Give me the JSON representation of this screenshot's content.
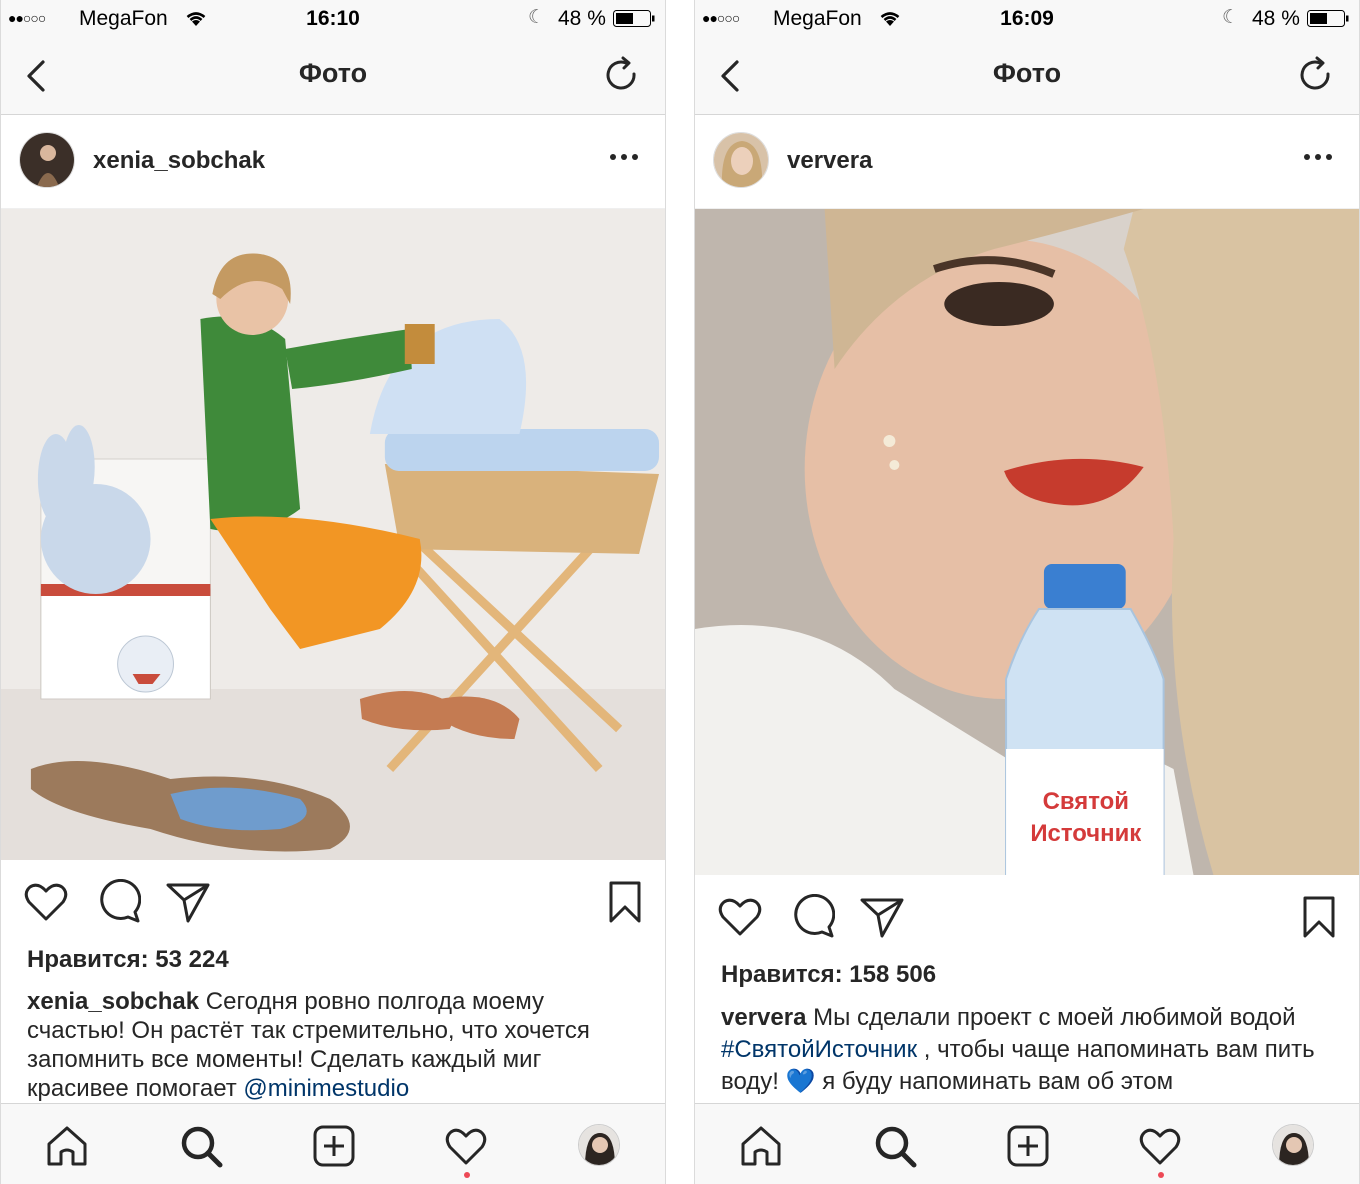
{
  "screens": [
    {
      "status": {
        "carrier": "MegaFon",
        "time": "16:10",
        "battery": "48 %"
      },
      "nav": {
        "title": "Фото"
      },
      "post": {
        "username": "xenia_sobchak",
        "likes": "Нравится: 53 224",
        "caption_user": "xenia_sobchak",
        "caption_text": " Сегодня ровно полгода моему счастью! Он растёт так стремительно, что хочется запомнить все моменты! Сделать каждый миг красивее помогает ",
        "caption_link": "@minimestudio"
      }
    },
    {
      "status": {
        "carrier": "MegaFon",
        "time": "16:09",
        "battery": "48 %"
      },
      "nav": {
        "title": "Фото"
      },
      "post": {
        "username": "ververa",
        "likes": "Нравится: 158 506",
        "caption_user": "ververa",
        "caption_text_1": " Мы сделали проект с моей любимой водой ",
        "caption_hashtag": "#СвятойИсточник",
        "caption_text_2": " , чтобы чаще напоминать вам пить воду! ",
        "caption_emoji": "💙",
        "caption_text_3": " я буду напоминать вам об этом",
        "bottle_label": "Святой Источник"
      }
    }
  ],
  "icons": {
    "wifi": "wifi-icon",
    "moon": "moon-icon",
    "battery": "battery-icon",
    "back": "chevron-left-icon",
    "refresh": "refresh-icon",
    "more": "ellipsis-icon",
    "like": "heart-icon",
    "comment": "comment-icon",
    "share": "paper-plane-icon",
    "save": "bookmark-icon",
    "home": "home-icon",
    "search": "search-icon",
    "add": "plus-square-icon",
    "activity": "heart-icon"
  },
  "colors": {
    "link": "#003569",
    "text": "#262626",
    "notification_dot": "#ed4956",
    "bar_bg": "#f8f8f8"
  }
}
